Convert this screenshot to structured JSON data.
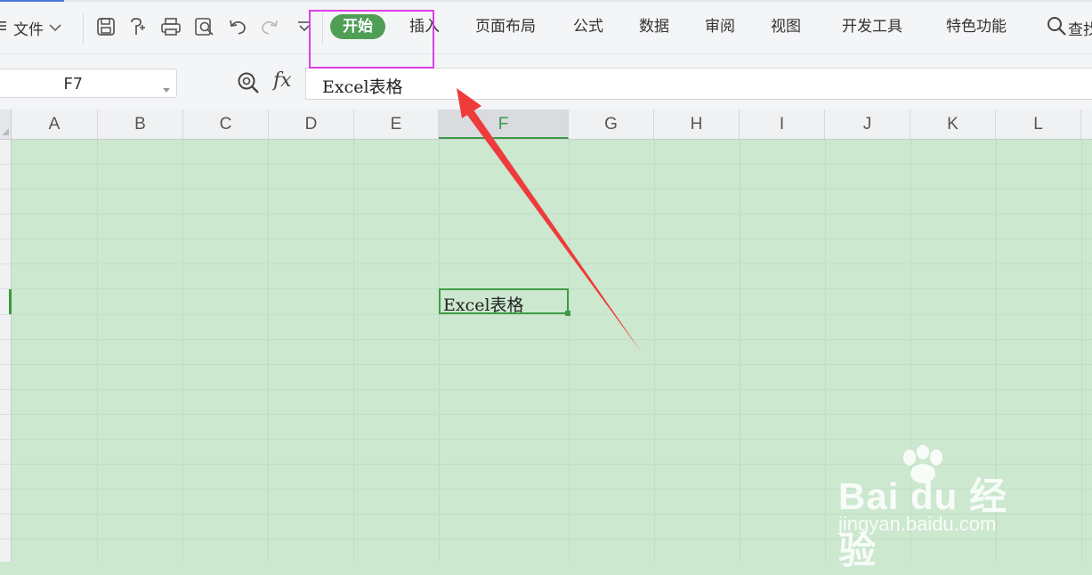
{
  "menubar": {
    "file_label": "文件",
    "tabs": [
      "开始",
      "插入",
      "页面布局",
      "公式",
      "数据",
      "审阅",
      "视图",
      "开发工具",
      "特色功能"
    ],
    "search_label": "查找"
  },
  "formula": {
    "name_box": "F7",
    "fx_label": "fx",
    "value": "Excel表格"
  },
  "sheet": {
    "columns": [
      "A",
      "B",
      "C",
      "D",
      "E",
      "F",
      "G",
      "H",
      "I",
      "J",
      "K",
      "L"
    ],
    "active_column": "F",
    "active_cell_value": "Excel表格"
  },
  "annotation": {
    "highlight_color": "#de3ee6",
    "arrow_color": "#ee3b3b"
  },
  "watermark": {
    "brand": "Bai du 经验",
    "url": "jingyan.baidu.com"
  },
  "colors": {
    "accent_green": "#4f9e56",
    "sheet_background": "#cce8cf"
  }
}
